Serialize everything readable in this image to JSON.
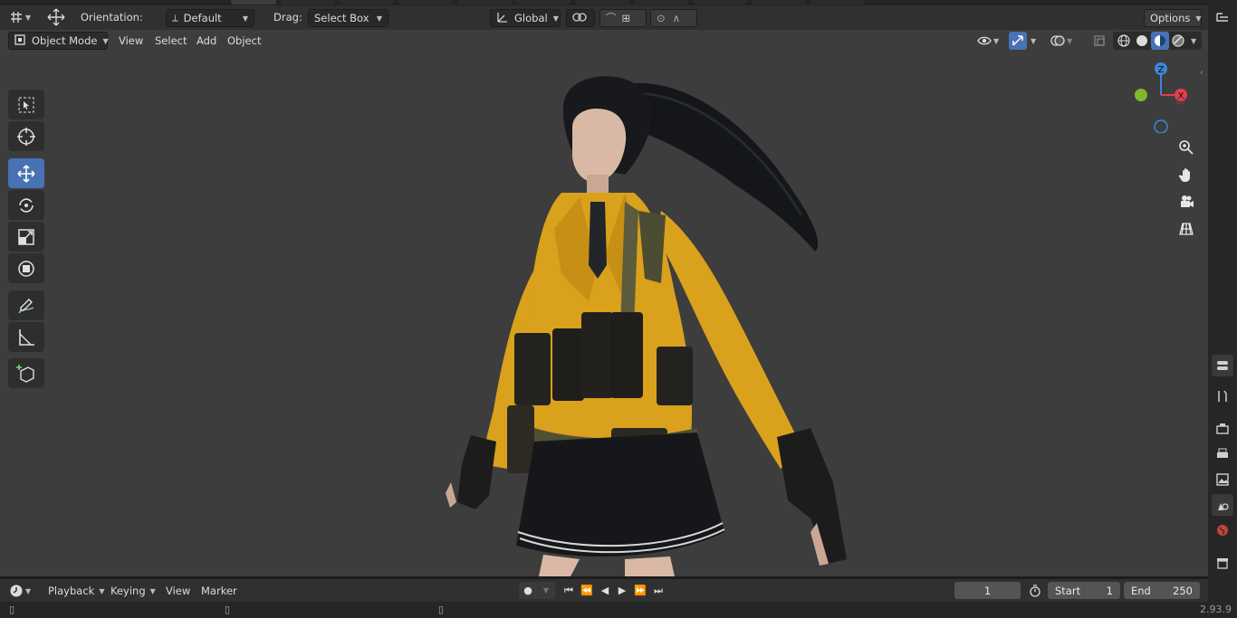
{
  "header": {
    "orientation_label": "Orientation:",
    "orientation_value": "Default",
    "drag_label": "Drag:",
    "drag_value": "Select Box",
    "transform_space": "Global",
    "options_label": "Options"
  },
  "viewport_header": {
    "mode": "Object Mode",
    "menus": [
      "View",
      "Select",
      "Add",
      "Object"
    ]
  },
  "gizmo": {
    "x_label": "X",
    "z_label": "Z"
  },
  "timeline": {
    "menus": [
      "Playback",
      "Keying",
      "View",
      "Marker"
    ],
    "current_frame": "1",
    "start_label": "Start",
    "start_value": "1",
    "end_label": "End",
    "end_value": "250"
  },
  "status": {
    "version": "2.93.9"
  },
  "icons": {
    "editor_type": "editor-type-icon",
    "transform_pivot": "move-arrows-icon",
    "shading_modes": [
      "wireframe-icon",
      "solid-icon",
      "material-preview-icon",
      "rendered-icon"
    ]
  },
  "colors": {
    "accent": "#4772b3",
    "axis_x": "#e0404d",
    "axis_y": "#7fb92e",
    "axis_z": "#3b87d9",
    "jacket": "#d9a11c"
  }
}
